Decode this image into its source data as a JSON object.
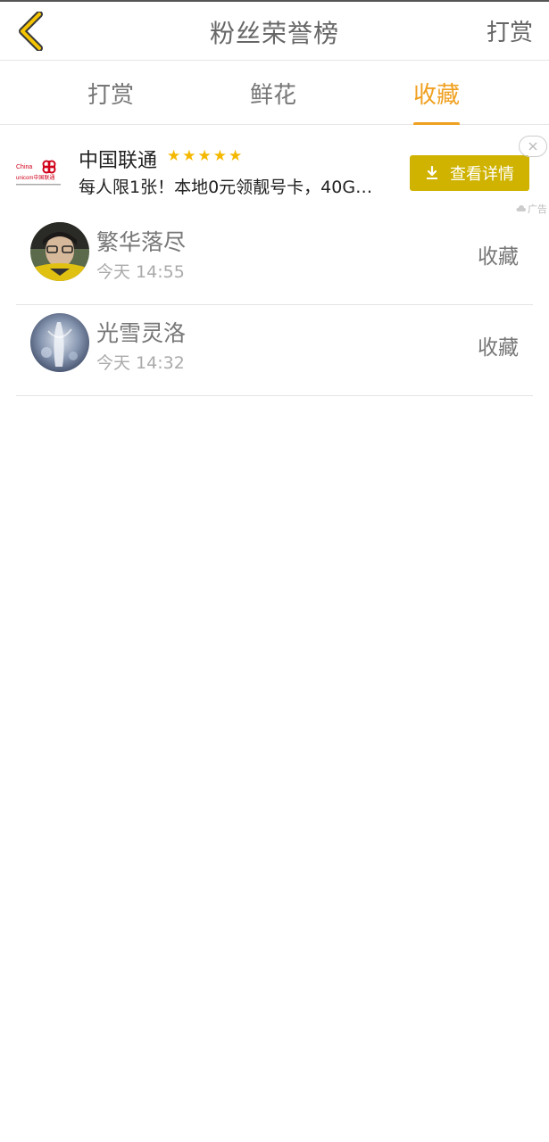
{
  "header": {
    "title": "粉丝荣誉榜",
    "action_label": "打赏",
    "back_icon": "chevron-left-icon",
    "accent_color": "#f0a020"
  },
  "tabs": [
    {
      "label": "打赏",
      "active": false
    },
    {
      "label": "鲜花",
      "active": false
    },
    {
      "label": "收藏",
      "active": true
    }
  ],
  "ad": {
    "title": "中国联通",
    "rating_stars": "★★★★★",
    "rating": 5,
    "description": "每人限1张！本地0元领靓号卡，40G…",
    "button_label": "查看详情",
    "tag": "广告",
    "logo_text_top": "China",
    "logo_text_bottom": "unicom中国联通",
    "button_color": "#cfb300"
  },
  "list": [
    {
      "name": "繁华落尽",
      "time": "今天 14:55",
      "action": "收藏"
    },
    {
      "name": "光雪灵洛",
      "time": "今天 14:32",
      "action": "收藏"
    }
  ]
}
